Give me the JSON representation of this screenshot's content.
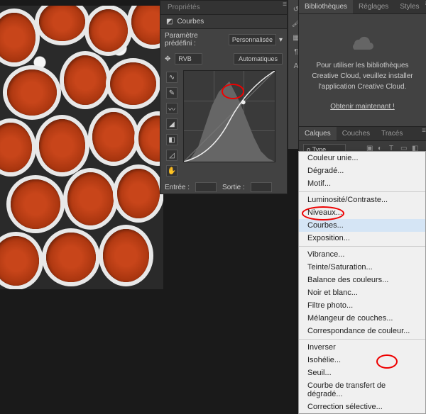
{
  "properties": {
    "panel_title": "Propriétés",
    "tab_label": "Courbes",
    "preset_label": "Paramètre prédéfini :",
    "preset_value": "Personnalisée",
    "channel_value": "RVB",
    "auto_label": "Automatiques",
    "entry_label": "Entrée :",
    "output_label": "Sortie :",
    "tools": [
      "curve-tool",
      "pencil-tool",
      "smooth-tool",
      "sampler-black",
      "sampler-gray",
      "sampler-white",
      "hand-tool"
    ]
  },
  "libraries": {
    "tabs": [
      "Bibliothèques",
      "Réglages",
      "Styles"
    ],
    "message": "Pour utiliser les bibliothèques Creative Cloud, veuillez installer l'application Creative Cloud.",
    "link": "Obtenir maintenant !"
  },
  "layers": {
    "tabs": [
      "Calques",
      "Couches",
      "Tracés"
    ],
    "filter_label": "ρ Type"
  },
  "adjustment_menu": {
    "items": [
      {
        "label": "Couleur unie...",
        "sep": false
      },
      {
        "label": "Dégradé...",
        "sep": false
      },
      {
        "label": "Motif...",
        "sep": true
      },
      {
        "label": "Luminosité/Contraste...",
        "sep": false
      },
      {
        "label": "Niveaux...",
        "sep": false
      },
      {
        "label": "Courbes...",
        "sep": false,
        "highlight": true
      },
      {
        "label": "Exposition...",
        "sep": true
      },
      {
        "label": "Vibrance...",
        "sep": false
      },
      {
        "label": "Teinte/Saturation...",
        "sep": false
      },
      {
        "label": "Balance des couleurs...",
        "sep": false
      },
      {
        "label": "Noir et blanc...",
        "sep": false
      },
      {
        "label": "Filtre photo...",
        "sep": false
      },
      {
        "label": "Mélangeur de couches...",
        "sep": false
      },
      {
        "label": "Correspondance de couleur...",
        "sep": true
      },
      {
        "label": "Inverser",
        "sep": false
      },
      {
        "label": "Isohélie...",
        "sep": false
      },
      {
        "label": "Seuil...",
        "sep": false
      },
      {
        "label": "Courbe de transfert de dégradé...",
        "sep": false
      },
      {
        "label": "Correction sélective...",
        "sep": false
      }
    ]
  },
  "chart_data": {
    "type": "line",
    "title": "Courbes (RVB)",
    "xlabel": "Entrée",
    "ylabel": "Sortie",
    "xlim": [
      0,
      255
    ],
    "ylim": [
      0,
      255
    ],
    "series": [
      {
        "name": "curve",
        "values": [
          [
            0,
            0
          ],
          [
            60,
            30
          ],
          [
            128,
            115
          ],
          [
            170,
            190
          ],
          [
            255,
            255
          ]
        ]
      }
    ],
    "histogram_peaks": [
      30,
      45,
      70,
      95,
      120,
      150,
      180,
      210,
      235
    ]
  }
}
